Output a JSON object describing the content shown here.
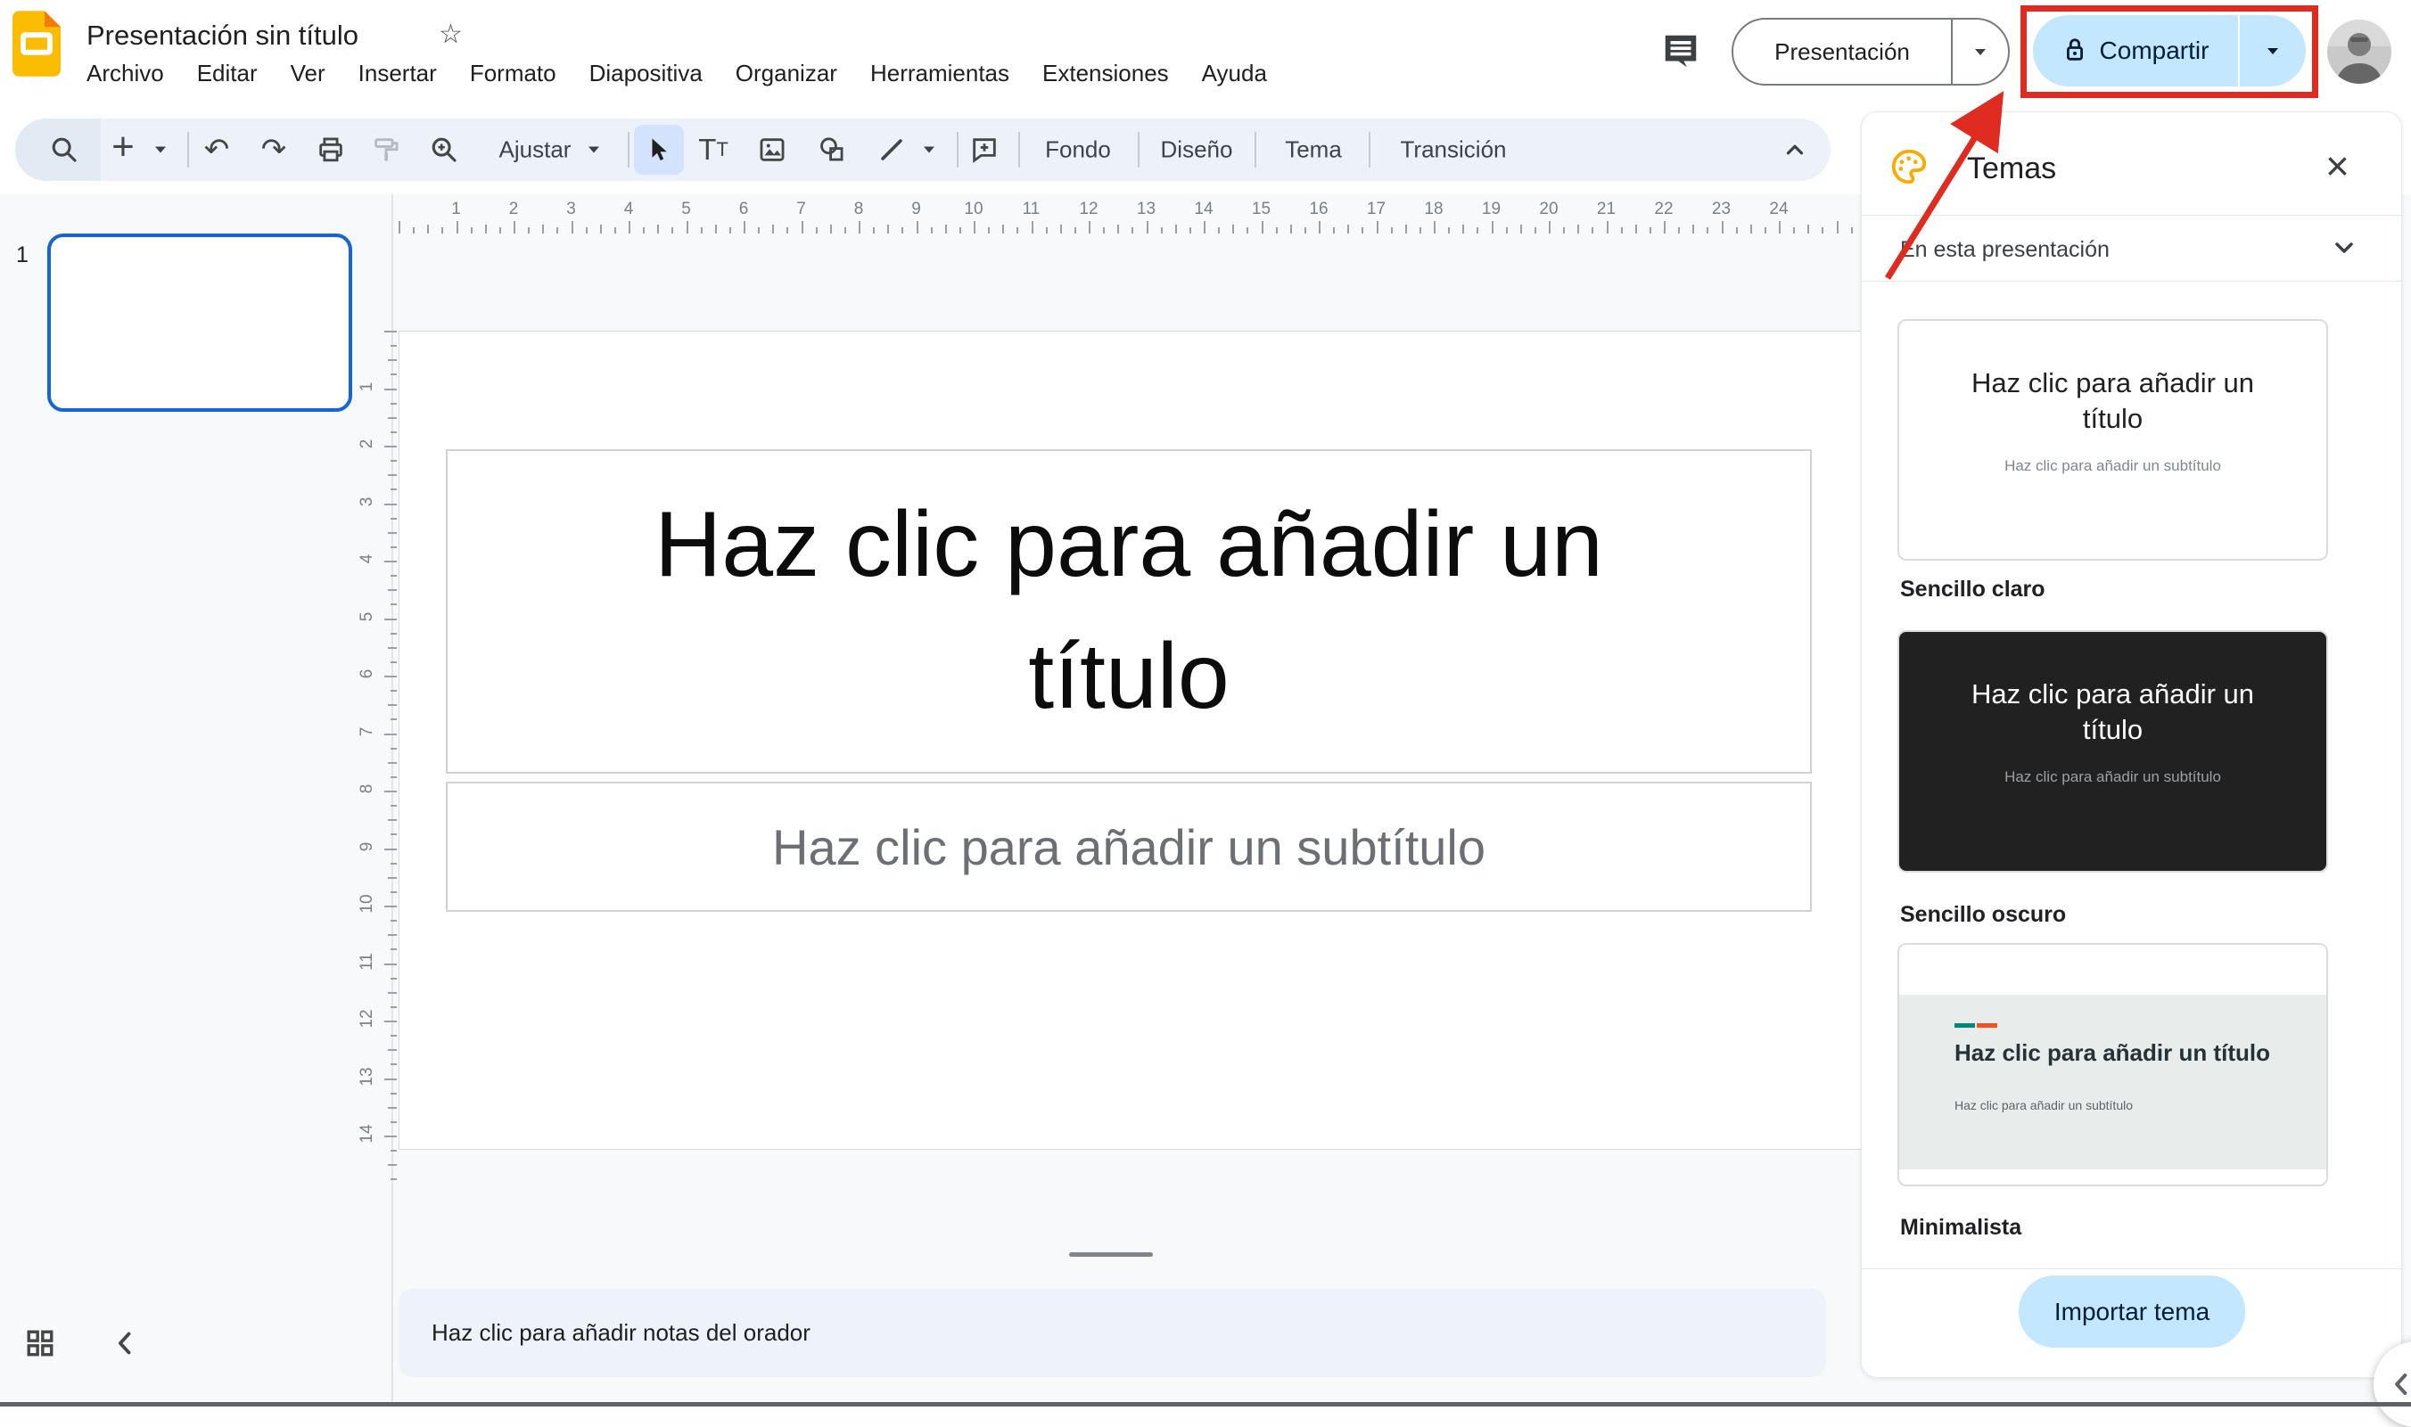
{
  "header": {
    "doc_title": "Presentación sin título",
    "menu_items": [
      "Archivo",
      "Editar",
      "Ver",
      "Insertar",
      "Formato",
      "Diapositiva",
      "Organizar",
      "Herramientas",
      "Extensiones",
      "Ayuda"
    ],
    "presentation_button_label": "Presentación",
    "share_button_label": "Compartir"
  },
  "toolbar": {
    "zoom_fit_label": "Ajustar",
    "fondo_label": "Fondo",
    "diseno_label": "Diseño",
    "tema_label": "Tema",
    "transicion_label": "Transición"
  },
  "filmstrip": {
    "slide_number": "1"
  },
  "rulers": {
    "top_numbers": [
      1,
      2,
      3,
      4,
      5,
      6,
      7,
      8,
      9,
      10,
      11,
      12,
      13,
      14,
      15,
      16,
      17,
      18,
      19,
      20,
      21,
      22,
      23,
      24
    ],
    "left_numbers": [
      1,
      2,
      3,
      4,
      5,
      6,
      7,
      8,
      9,
      10,
      11,
      12,
      13,
      14
    ]
  },
  "slide": {
    "title_placeholder": "Haz clic para añadir un título",
    "subtitle_placeholder": "Haz clic para añadir un subtítulo"
  },
  "notes": {
    "placeholder": "Haz clic para añadir notas del orador"
  },
  "themes_panel": {
    "title": "Temas",
    "section_label": "En esta presentación",
    "themes": [
      {
        "name": "Sencillo claro",
        "title_text": "Haz clic para añadir un título",
        "subtitle_text": "Haz clic para añadir un subtítulo"
      },
      {
        "name": "Sencillo oscuro",
        "title_text": "Haz clic para añadir un título",
        "subtitle_text": "Haz clic para añadir un subtítulo"
      },
      {
        "name": "Minimalista",
        "title_text": "Haz clic para añadir un título",
        "subtitle_text": "Haz clic para añadir un subtítulo"
      }
    ],
    "import_button_label": "Importar tema"
  },
  "colors": {
    "share_button_bg": "#c2e7ff",
    "share_button_text": "#001d35",
    "annotation_red": "#e02b20",
    "selected_slide_border": "#1565d8",
    "toolbar_bg": "#edf2fa",
    "workspace_bg": "#f8f9fa",
    "notes_bg": "#edf2fb",
    "dark_theme_bg": "#212121",
    "palette_icon": "#f9ab00",
    "logo_yellow": "#fbbc04"
  }
}
